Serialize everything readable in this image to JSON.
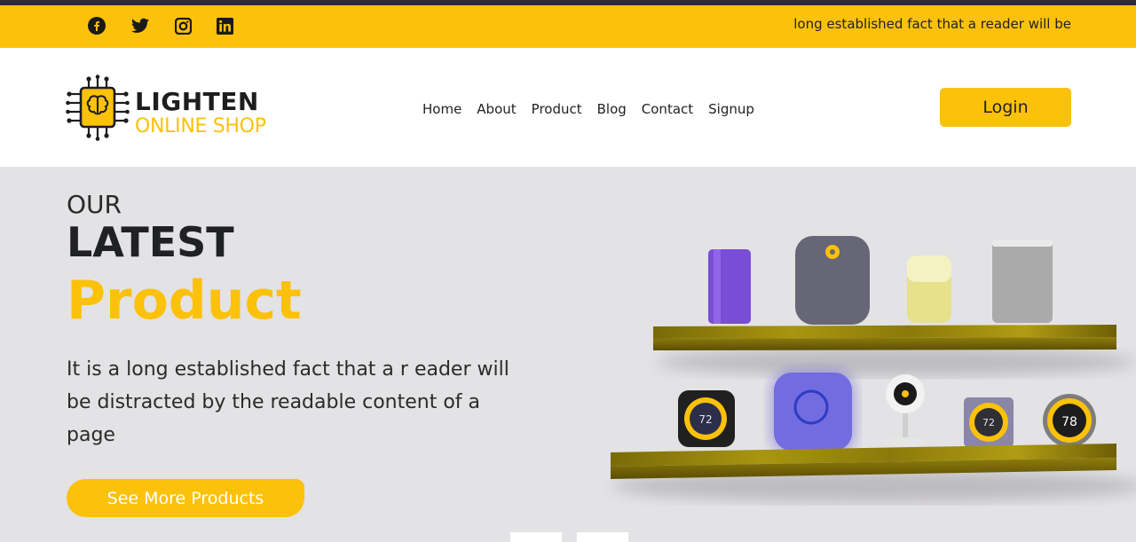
{
  "topbar": {
    "social": [
      {
        "icon": "facebook-icon"
      },
      {
        "icon": "twitter-icon"
      },
      {
        "icon": "instagram-icon"
      },
      {
        "icon": "linkedin-icon"
      }
    ],
    "marquee": "long established fact that a reader will be"
  },
  "header": {
    "logo_title": "LIGHTEN",
    "logo_sub": "ONLINE SHOP",
    "nav": [
      "Home",
      "About",
      "Product",
      "Blog",
      "Contact",
      "Signup"
    ],
    "login": "Login"
  },
  "hero": {
    "our": "OUR",
    "latest": "LATEST",
    "product": "Product",
    "description": "It is a long established fact that a r eader will be distracted by the readable content of a page",
    "cta": "See More Products",
    "device_labels": [
      "72",
      "72",
      "78"
    ]
  },
  "colors": {
    "accent": "#fcc10a",
    "dark": "#1f2125",
    "hero_bg": "#e3e2e4"
  }
}
